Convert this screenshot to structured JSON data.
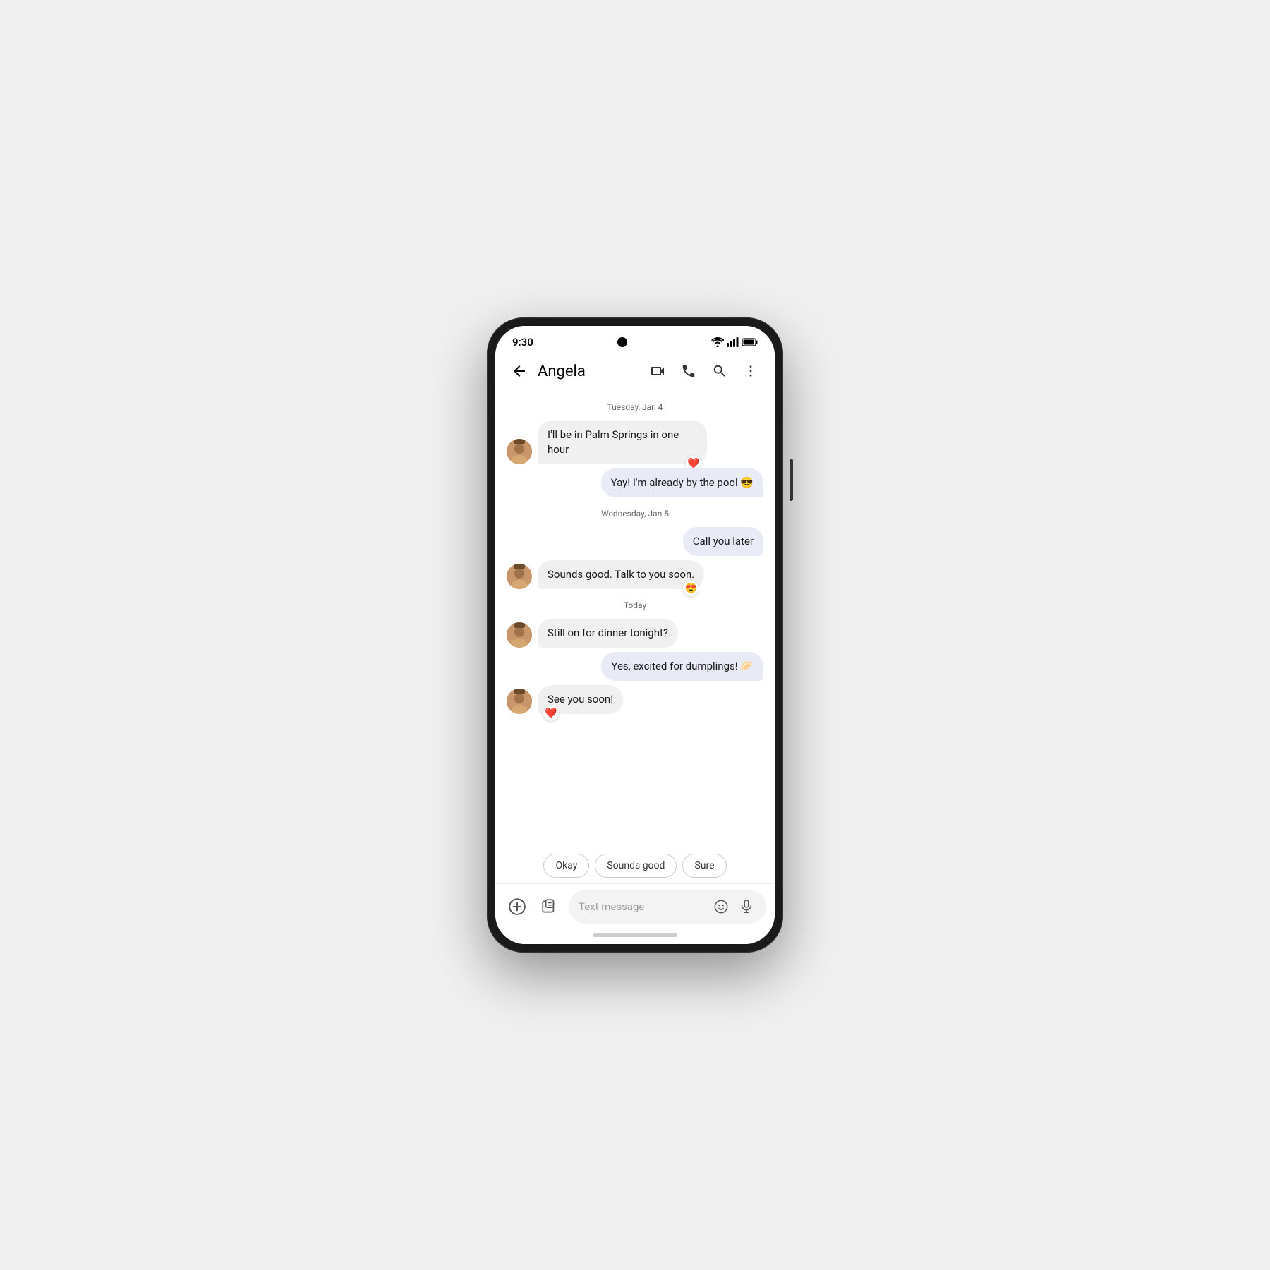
{
  "phone": {
    "status_bar": {
      "time": "9:30"
    },
    "app_bar": {
      "contact_name": "Angela",
      "back_label": "back",
      "video_call_label": "video call",
      "phone_call_label": "phone call",
      "search_label": "search",
      "more_label": "more options"
    },
    "chat": {
      "date_dividers": [
        "Tuesday, Jan 4",
        "Wednesday, Jan 5",
        "Today"
      ],
      "messages": [
        {
          "id": 1,
          "type": "incoming",
          "text": "I'll be in Palm Springs in one hour",
          "reaction": "❤️",
          "reaction_side": "right",
          "date_group": "Tuesday, Jan 4"
        },
        {
          "id": 2,
          "type": "outgoing",
          "text": "Yay! I'm already by the pool 😎",
          "date_group": "Tuesday, Jan 4"
        },
        {
          "id": 3,
          "type": "outgoing",
          "text": "Call you later",
          "date_group": "Wednesday, Jan 5"
        },
        {
          "id": 4,
          "type": "incoming",
          "text": "Sounds good. Talk to you soon.",
          "reaction": "😍",
          "reaction_side": "right",
          "date_group": "Wednesday, Jan 5"
        },
        {
          "id": 5,
          "type": "incoming",
          "text": "Still on for dinner tonight?",
          "date_group": "Today"
        },
        {
          "id": 6,
          "type": "outgoing",
          "text": "Yes, excited for dumplings! 🥟",
          "date_group": "Today"
        },
        {
          "id": 7,
          "type": "incoming",
          "text": "See you soon!",
          "reaction": "❤️",
          "reaction_side": "left",
          "date_group": "Today"
        }
      ],
      "quick_replies": [
        "Okay",
        "Sounds good",
        "Sure"
      ]
    },
    "input_bar": {
      "placeholder": "Text message",
      "add_label": "add",
      "attachment_label": "attachment",
      "emoji_label": "emoji",
      "mic_label": "microphone"
    }
  }
}
